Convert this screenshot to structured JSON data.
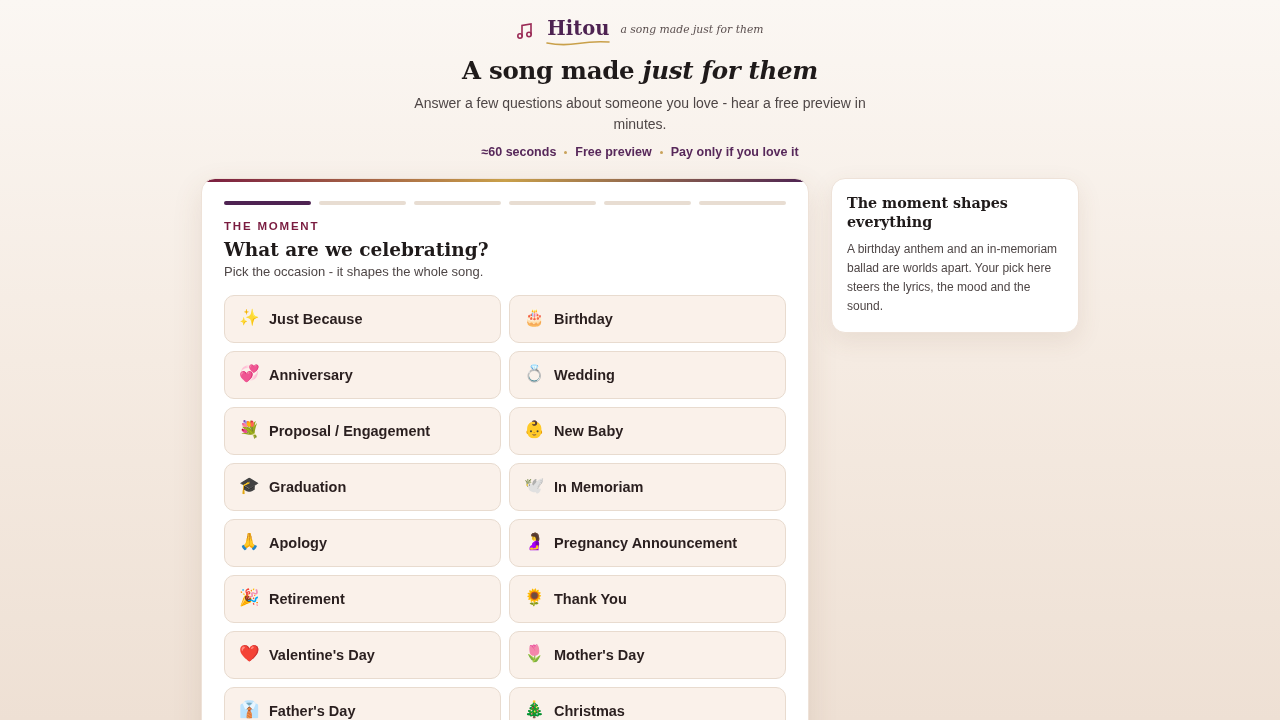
{
  "brand": {
    "name": "Hitou",
    "tagline": "a song made just for them"
  },
  "hero": {
    "title": "A song made *just for them*",
    "subtitle": "Answer a few questions about someone you love - hear a free preview in minutes.",
    "perks": [
      "≈60 seconds",
      "Free preview",
      "Pay only if you love it"
    ]
  },
  "wizard": {
    "steps": [
      {
        "complete": true
      },
      {
        "complete": false
      },
      {
        "complete": false
      },
      {
        "complete": false
      },
      {
        "complete": false
      },
      {
        "complete": false
      }
    ],
    "eyebrow": "THE MOMENT",
    "question": "What are we celebrating?",
    "hint": "Pick the occasion - it shapes the whole song.",
    "options": [
      {
        "emoji": "✨",
        "label": "Just Because",
        "selected": false
      },
      {
        "emoji": "🎂",
        "label": "Birthday",
        "selected": false
      },
      {
        "emoji": "💞",
        "label": "Anniversary",
        "selected": false
      },
      {
        "emoji": "💍",
        "label": "Wedding",
        "selected": false
      },
      {
        "emoji": "💐",
        "label": "Proposal / Engagement",
        "selected": false
      },
      {
        "emoji": "👶",
        "label": "New Baby",
        "selected": false
      },
      {
        "emoji": "🎓",
        "label": "Graduation",
        "selected": false
      },
      {
        "emoji": "🕊️",
        "label": "In Memoriam",
        "selected": false
      },
      {
        "emoji": "🙏",
        "label": "Apology",
        "selected": false
      },
      {
        "emoji": "🤰",
        "label": "Pregnancy Announcement",
        "selected": false
      },
      {
        "emoji": "🎉",
        "label": "Retirement",
        "selected": false
      },
      {
        "emoji": "🌻",
        "label": "Thank You",
        "selected": false
      },
      {
        "emoji": "❤️",
        "label": "Valentine's Day",
        "selected": false
      },
      {
        "emoji": "🌷",
        "label": "Mother's Day",
        "selected": false
      },
      {
        "emoji": "👔",
        "label": "Father's Day",
        "selected": false
      },
      {
        "emoji": "🎄",
        "label": "Christmas",
        "selected": false
      }
    ]
  },
  "aside": {
    "title": "The moment shapes everything",
    "body": "A birthday anthem and an in-memoriam ballad are worlds apart. Your pick here steers the lyrics, the mood and the sound."
  }
}
